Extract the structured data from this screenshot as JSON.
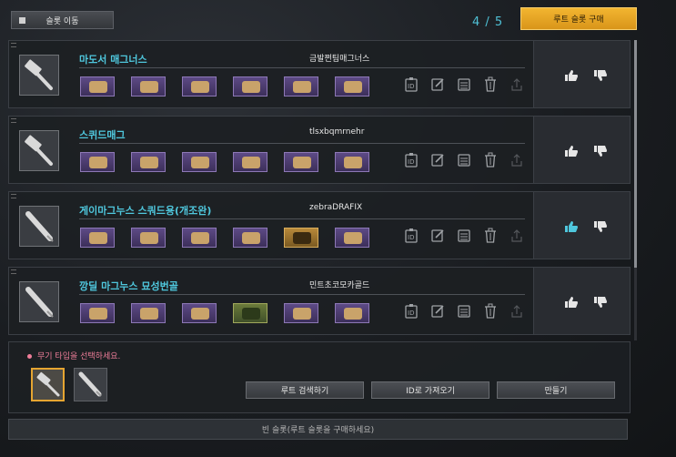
{
  "header": {
    "move_slot_label": "슬롯 이동",
    "counter": "4 / 5",
    "buy_slot_label": "루트 슬롯 구매"
  },
  "builds": [
    {
      "name": "마도서 매그너스",
      "author": "금발쩐팀매그너스",
      "weapon": "hammer-icon",
      "vote_up_active": false,
      "items": [
        "purple",
        "purple",
        "purple",
        "purple",
        "purple",
        "purple"
      ]
    },
    {
      "name": "스퀴드매그",
      "author": "tlsxbqmrnehr",
      "weapon": "hammer-icon",
      "vote_up_active": false,
      "items": [
        "purple",
        "purple",
        "purple",
        "purple",
        "purple",
        "purple"
      ]
    },
    {
      "name": "게이마그누스 스쿼드용(개조완)",
      "author": "zebraDRAFIX",
      "weapon": "bat-icon",
      "vote_up_active": true,
      "items": [
        "purple",
        "purple",
        "purple",
        "purple",
        "gold",
        "purple"
      ]
    },
    {
      "name": "깡딜 마그누스 묘성번골",
      "author": "민트초코모카골드",
      "weapon": "bat-icon",
      "vote_up_active": false,
      "items": [
        "purple",
        "purple",
        "purple",
        "green",
        "purple",
        "purple"
      ]
    }
  ],
  "bottom": {
    "prompt": "무기 타입을 선택하세요.",
    "search_label": "루트 검색하기",
    "id_import_label": "ID로 가져오기",
    "create_label": "만들기"
  },
  "empty_slot_label": "빈 슬롯(루트 슬롯을 구매하세요)",
  "colors": {
    "accent_cyan": "#4fc7dd",
    "accent_gold": "#e6a531",
    "prompt_pink": "#f07e9a"
  }
}
